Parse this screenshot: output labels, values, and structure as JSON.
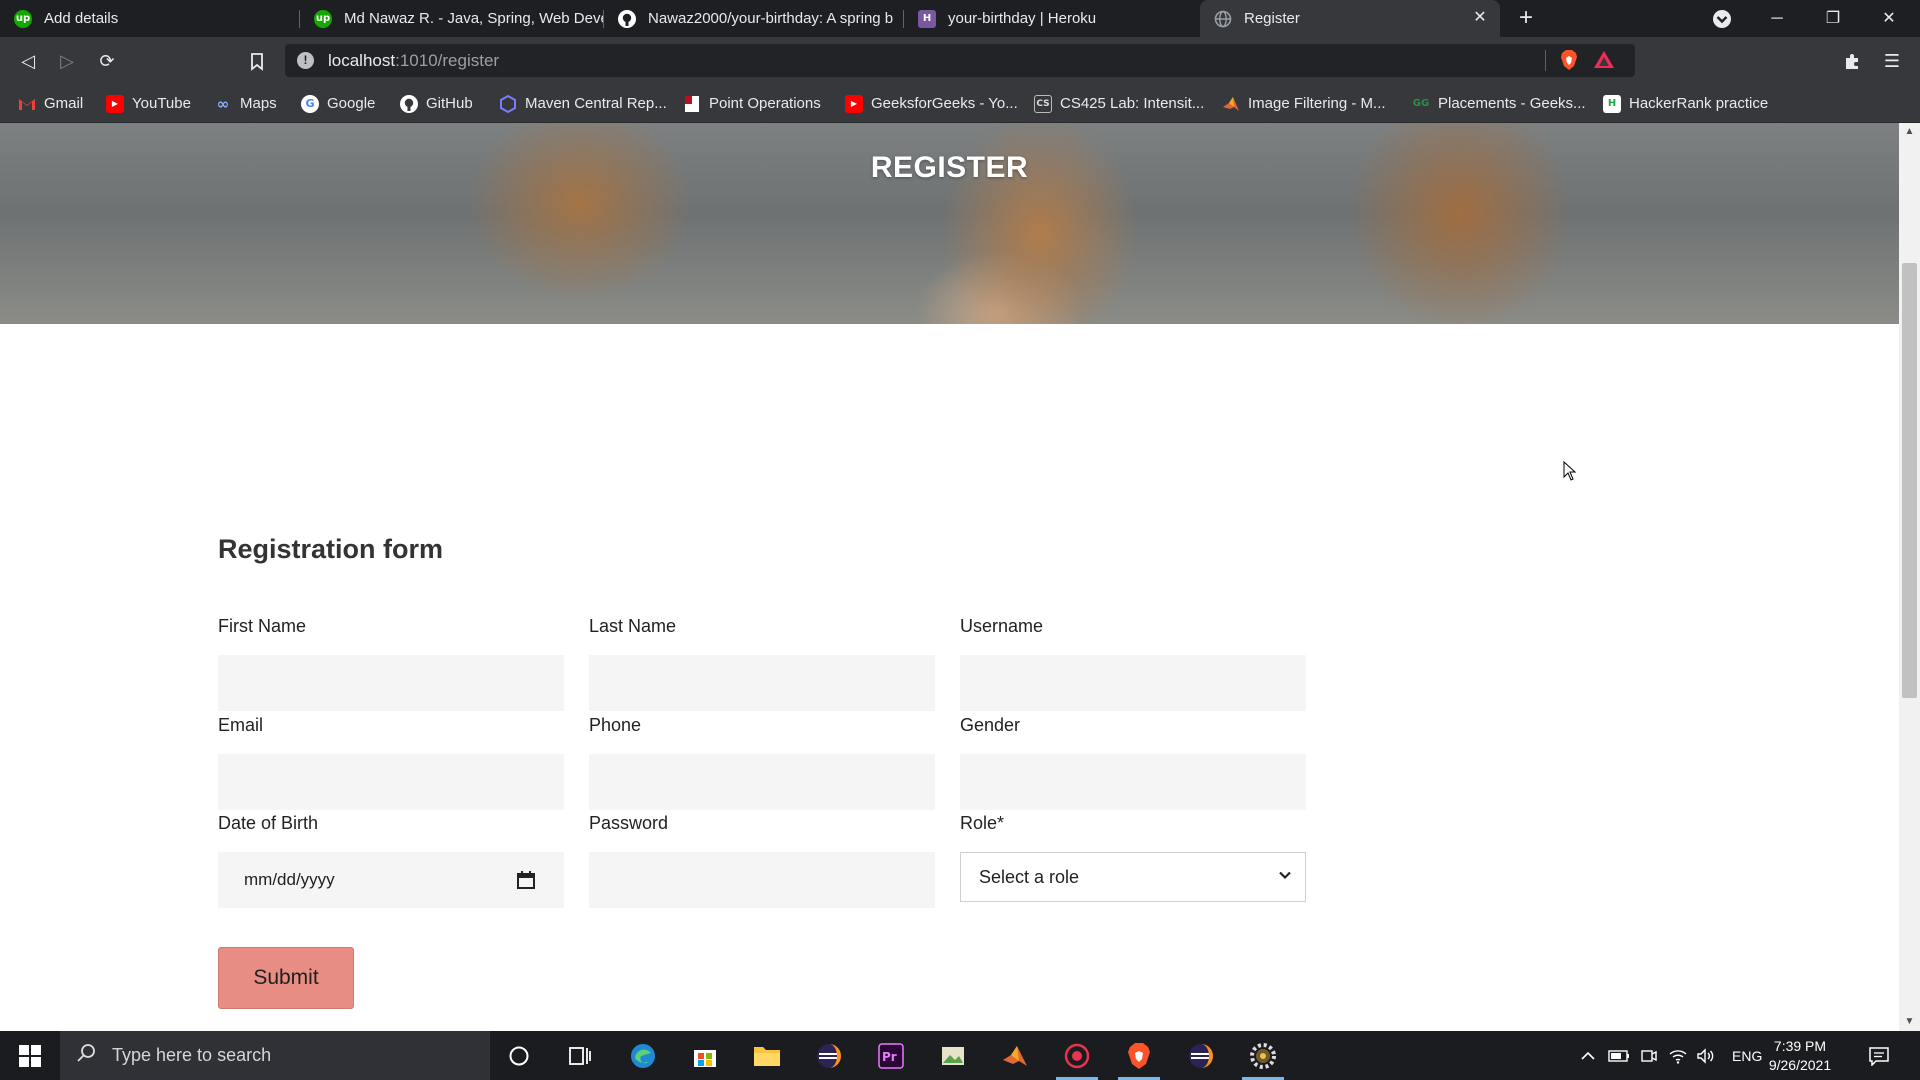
{
  "browser": {
    "tabs": [
      {
        "title": "Add details",
        "icon": "upwork-icon",
        "icon_color": "#14a800"
      },
      {
        "title": "Md Nawaz R. - Java, Spring, Web Deve",
        "icon": "upwork-icon",
        "icon_color": "#14a800"
      },
      {
        "title": "Nawaz2000/your-birthday: A spring b",
        "icon": "github-icon",
        "icon_color": "#ffffff"
      },
      {
        "title": "your-birthday | Heroku",
        "icon": "heroku-icon",
        "icon_color": "#79589f"
      },
      {
        "title": "Register",
        "icon": "globe-icon",
        "icon_color": "#9aa0a6",
        "active": true
      }
    ],
    "url_host": "localhost",
    "url_path": ":1010/register",
    "bookmarks": [
      {
        "label": "Gmail",
        "icon": "gmail-icon"
      },
      {
        "label": "YouTube",
        "icon": "youtube-icon"
      },
      {
        "label": "Maps",
        "icon": "maps-icon"
      },
      {
        "label": "Google",
        "icon": "google-icon"
      },
      {
        "label": "GitHub",
        "icon": "github-icon"
      },
      {
        "label": "Maven Central Rep...",
        "icon": "maven-icon"
      },
      {
        "label": "Point Operations",
        "icon": "bookmark-page-icon"
      },
      {
        "label": "GeeksforGeeks - Yo...",
        "icon": "youtube-icon"
      },
      {
        "label": "CS425 Lab: Intensit...",
        "icon": "cs-icon"
      },
      {
        "label": "Image Filtering - M...",
        "icon": "matlab-icon"
      },
      {
        "label": "Placements - Geeks...",
        "icon": "gfg-icon"
      },
      {
        "label": "HackerRank practice",
        "icon": "hackerrank-icon"
      }
    ]
  },
  "page": {
    "hero_title": "REGISTER",
    "form_title": "Registration form",
    "fields": {
      "first_name": {
        "label": "First Name",
        "value": ""
      },
      "last_name": {
        "label": "Last Name",
        "value": ""
      },
      "username": {
        "label": "Username",
        "value": ""
      },
      "email": {
        "label": "Email",
        "value": ""
      },
      "phone": {
        "label": "Phone",
        "value": ""
      },
      "gender": {
        "label": "Gender",
        "value": ""
      },
      "dob": {
        "label": "Date of Birth",
        "placeholder": "mm/dd/yyyy"
      },
      "password": {
        "label": "Password",
        "value": ""
      },
      "role": {
        "label": "Role*",
        "selected": "Select a role"
      }
    },
    "submit_label": "Submit"
  },
  "taskbar": {
    "search_placeholder": "Type here to search",
    "language": "ENG",
    "time": "7:39 PM",
    "date": "9/26/2021"
  },
  "colors": {
    "submit_bg": "#e88d84",
    "browser_dark": "#1e1f22",
    "toolbar": "#37383c"
  }
}
